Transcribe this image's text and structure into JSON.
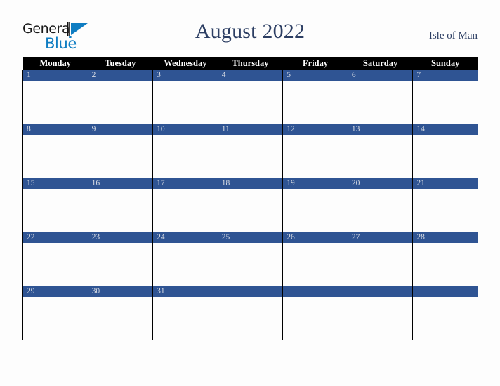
{
  "brand": {
    "line1": "General",
    "line2": "Blue",
    "mark_icon": "triangle-flag-icon",
    "line1_color": "#1a1a1a",
    "line2_color": "#0f7dc2"
  },
  "header": {
    "title": "August 2022",
    "location": "Isle of Man",
    "title_color": "#2c3e63"
  },
  "calendar": {
    "weekday_headers": [
      "Monday",
      "Tuesday",
      "Wednesday",
      "Thursday",
      "Friday",
      "Saturday",
      "Sunday"
    ],
    "header_bg": "#000000",
    "header_text_color": "#ffffff",
    "daynum_band_color": "#2f5493",
    "daynum_text_color": "#d7dbe3",
    "cell_bg": "#fdfdfd",
    "grid_line_color": "#000000",
    "weeks": [
      [
        {
          "day": "1",
          "note": ""
        },
        {
          "day": "2",
          "note": ""
        },
        {
          "day": "3",
          "note": ""
        },
        {
          "day": "4",
          "note": ""
        },
        {
          "day": "5",
          "note": ""
        },
        {
          "day": "6",
          "note": ""
        },
        {
          "day": "7",
          "note": ""
        }
      ],
      [
        {
          "day": "8",
          "note": ""
        },
        {
          "day": "9",
          "note": ""
        },
        {
          "day": "10",
          "note": ""
        },
        {
          "day": "11",
          "note": ""
        },
        {
          "day": "12",
          "note": ""
        },
        {
          "day": "13",
          "note": ""
        },
        {
          "day": "14",
          "note": ""
        }
      ],
      [
        {
          "day": "15",
          "note": ""
        },
        {
          "day": "16",
          "note": ""
        },
        {
          "day": "17",
          "note": ""
        },
        {
          "day": "18",
          "note": ""
        },
        {
          "day": "19",
          "note": ""
        },
        {
          "day": "20",
          "note": ""
        },
        {
          "day": "21",
          "note": ""
        }
      ],
      [
        {
          "day": "22",
          "note": ""
        },
        {
          "day": "23",
          "note": ""
        },
        {
          "day": "24",
          "note": ""
        },
        {
          "day": "25",
          "note": ""
        },
        {
          "day": "26",
          "note": ""
        },
        {
          "day": "27",
          "note": ""
        },
        {
          "day": "28",
          "note": ""
        }
      ],
      [
        {
          "day": "29",
          "note": ""
        },
        {
          "day": "30",
          "note": ""
        },
        {
          "day": "31",
          "note": ""
        },
        {
          "day": "",
          "note": ""
        },
        {
          "day": "",
          "note": ""
        },
        {
          "day": "",
          "note": ""
        },
        {
          "day": "",
          "note": ""
        }
      ]
    ]
  }
}
